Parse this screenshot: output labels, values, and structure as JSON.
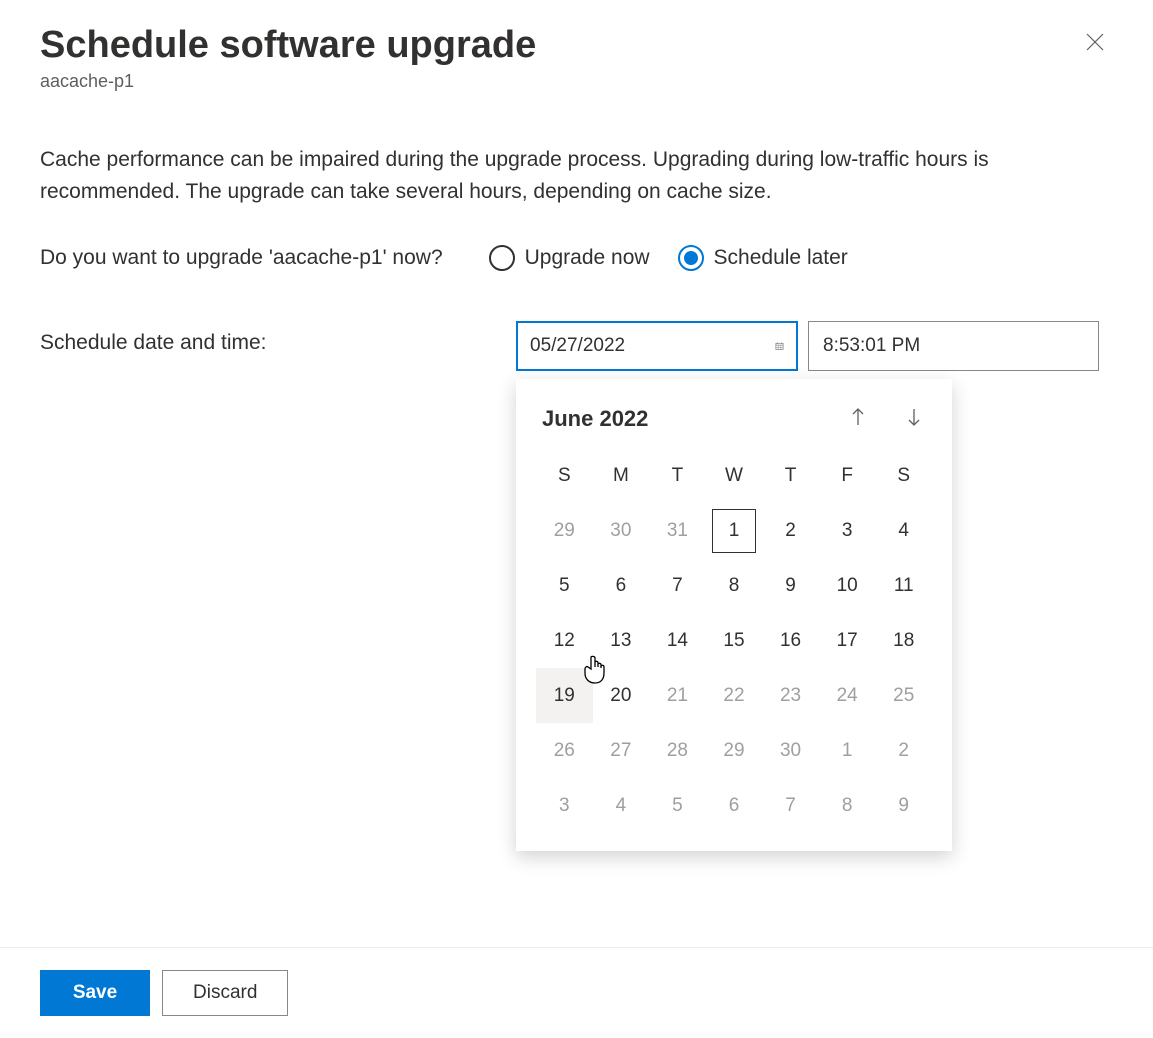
{
  "header": {
    "title": "Schedule software upgrade",
    "subtitle": "aacache-p1"
  },
  "description": "Cache performance can be impaired during the upgrade process. Upgrading during low-traffic hours is recommended. The upgrade can take several hours, depending on cache size.",
  "question": {
    "label": "Do you want to upgrade 'aacache-p1' now?",
    "options": {
      "upgrade_now": "Upgrade now",
      "schedule_later": "Schedule later"
    },
    "selected": "schedule_later"
  },
  "schedule": {
    "label": "Schedule date and time:",
    "date_value": "05/27/2022",
    "time_value": "8:53:01 PM"
  },
  "calendar": {
    "month_year": "June 2022",
    "weekdays": [
      "S",
      "M",
      "T",
      "W",
      "T",
      "F",
      "S"
    ],
    "weeks": [
      [
        {
          "n": "29",
          "other": true
        },
        {
          "n": "30",
          "other": true
        },
        {
          "n": "31",
          "other": true
        },
        {
          "n": "1",
          "today": true
        },
        {
          "n": "2"
        },
        {
          "n": "3"
        },
        {
          "n": "4"
        }
      ],
      [
        {
          "n": "5"
        },
        {
          "n": "6"
        },
        {
          "n": "7"
        },
        {
          "n": "8"
        },
        {
          "n": "9"
        },
        {
          "n": "10"
        },
        {
          "n": "11"
        }
      ],
      [
        {
          "n": "12"
        },
        {
          "n": "13"
        },
        {
          "n": "14"
        },
        {
          "n": "15"
        },
        {
          "n": "16"
        },
        {
          "n": "17"
        },
        {
          "n": "18"
        }
      ],
      [
        {
          "n": "19",
          "hover": true
        },
        {
          "n": "20"
        },
        {
          "n": "21",
          "other": true
        },
        {
          "n": "22",
          "other": true
        },
        {
          "n": "23",
          "other": true
        },
        {
          "n": "24",
          "other": true
        },
        {
          "n": "25",
          "other": true
        }
      ],
      [
        {
          "n": "26",
          "other": true
        },
        {
          "n": "27",
          "other": true
        },
        {
          "n": "28",
          "other": true
        },
        {
          "n": "29",
          "other": true
        },
        {
          "n": "30",
          "other": true
        },
        {
          "n": "1",
          "other": true
        },
        {
          "n": "2",
          "other": true
        }
      ],
      [
        {
          "n": "3",
          "other": true
        },
        {
          "n": "4",
          "other": true
        },
        {
          "n": "5",
          "other": true
        },
        {
          "n": "6",
          "other": true
        },
        {
          "n": "7",
          "other": true
        },
        {
          "n": "8",
          "other": true
        },
        {
          "n": "9",
          "other": true
        }
      ]
    ]
  },
  "footer": {
    "save": "Save",
    "discard": "Discard"
  }
}
